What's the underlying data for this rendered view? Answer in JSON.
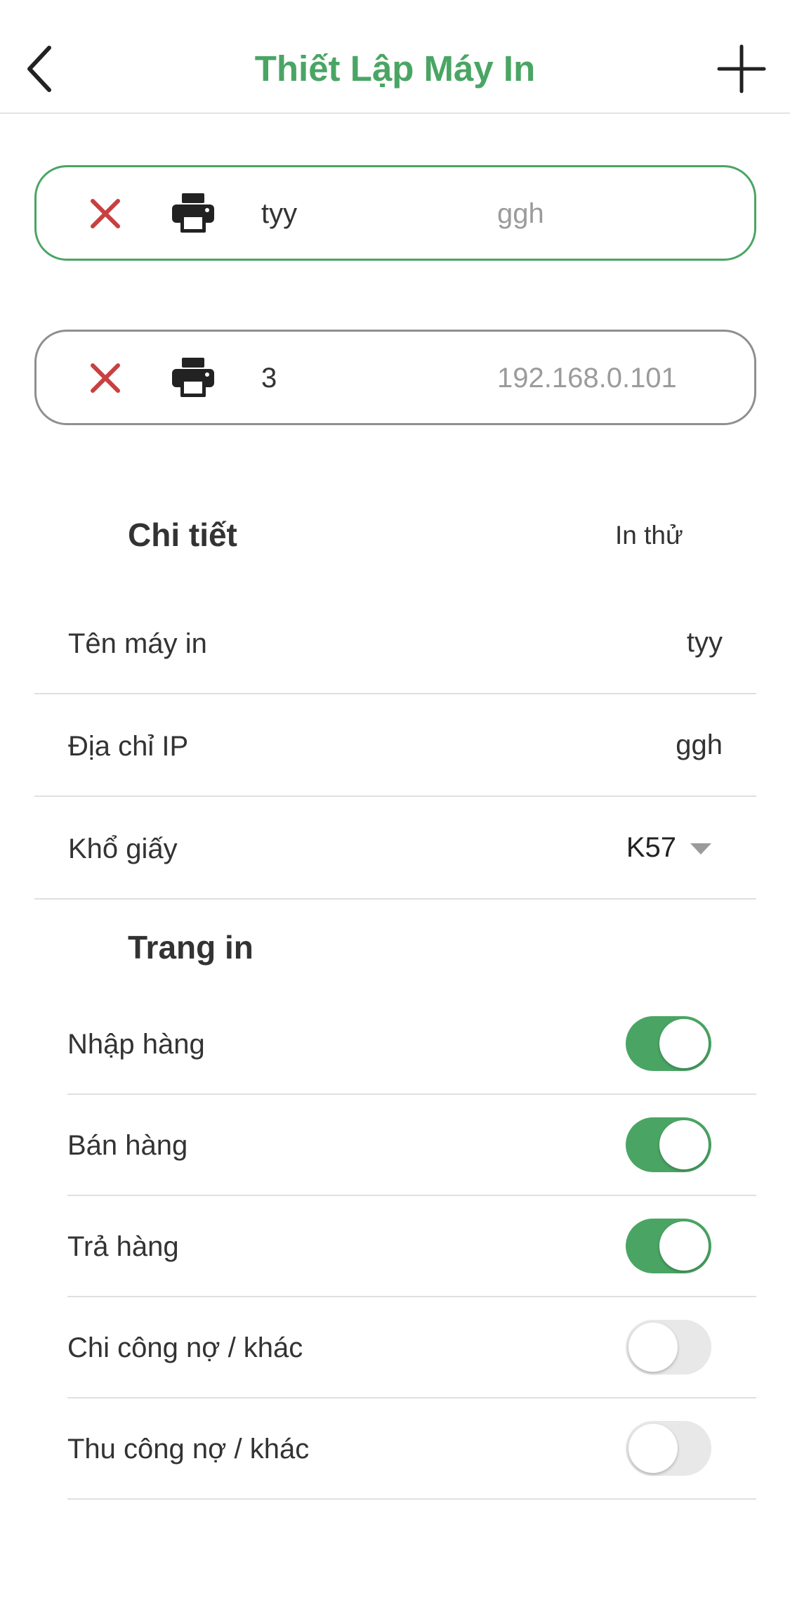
{
  "header": {
    "title": "Thiết Lập Máy In",
    "back_icon": "chevron-left-icon",
    "add_icon": "plus-icon"
  },
  "printers": [
    {
      "name": "tyy",
      "ip": "ggh",
      "selected": true
    },
    {
      "name": "3",
      "ip": "192.168.0.101",
      "selected": false
    }
  ],
  "detail": {
    "title": "Chi tiết",
    "test_print_label": "In thử",
    "rows": {
      "printer_name": {
        "label": "Tên máy in",
        "value": "tyy"
      },
      "ip_address": {
        "label": "Địa chỉ IP",
        "value": "ggh"
      },
      "paper_size": {
        "label": "Khổ giấy",
        "value": "K57"
      }
    }
  },
  "print_pages": {
    "title": "Trang in",
    "items": [
      {
        "label": "Nhập hàng",
        "enabled": true
      },
      {
        "label": "Bán hàng",
        "enabled": true
      },
      {
        "label": "Trả hàng",
        "enabled": true
      },
      {
        "label": "Chi công nợ / khác",
        "enabled": false
      },
      {
        "label": "Thu công nợ / khác",
        "enabled": false
      }
    ]
  },
  "colors": {
    "accent": "#4aa564",
    "remove": "#c8403f",
    "toggle_off": "#e8e8e8",
    "muted_text": "#9b9b9b"
  }
}
